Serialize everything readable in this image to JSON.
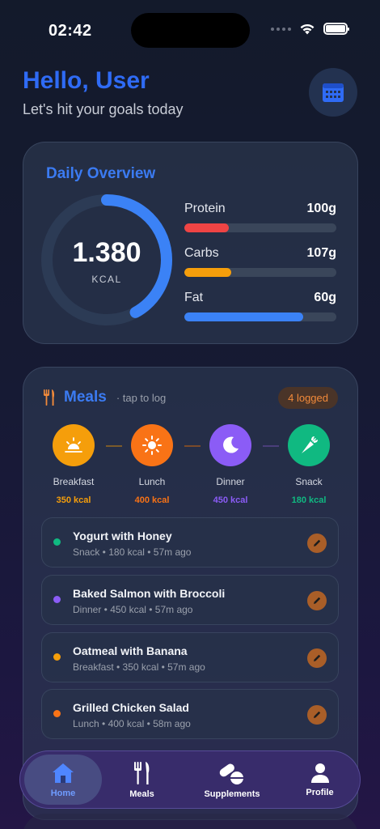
{
  "status": {
    "time": "02:42"
  },
  "header": {
    "greeting": "Hello, User",
    "subtitle": "Let's hit your goals today"
  },
  "overview": {
    "title": "Daily Overview",
    "calories": "1.380",
    "calories_unit": "KCAL",
    "ring_progress": 0.42,
    "macros": [
      {
        "name": "Protein",
        "value": "100g",
        "progress": 0.29,
        "color": "#ef4444"
      },
      {
        "name": "Carbs",
        "value": "107g",
        "progress": 0.31,
        "color": "#f59e0b"
      },
      {
        "name": "Fat",
        "value": "60g",
        "progress": 0.78,
        "color": "#3b82f6"
      }
    ]
  },
  "meals": {
    "title": "Meals",
    "hint": "· tap to log",
    "logged": "4 logged",
    "types": [
      {
        "label": "Breakfast",
        "kcal": "350 kcal",
        "color": "#f59e0b",
        "icon": "sunrise-icon"
      },
      {
        "label": "Lunch",
        "kcal": "400 kcal",
        "color": "#f97316",
        "icon": "sun-icon"
      },
      {
        "label": "Dinner",
        "kcal": "450 kcal",
        "color": "#8b5cf6",
        "icon": "moon-icon"
      },
      {
        "label": "Snack",
        "kcal": "180 kcal",
        "color": "#10b981",
        "icon": "carrot-icon"
      }
    ],
    "items": [
      {
        "name": "Yogurt with Honey",
        "meta": "Snack • 180 kcal • 57m ago",
        "color": "#10b981"
      },
      {
        "name": "Baked Salmon with Broccoli",
        "meta": "Dinner • 450 kcal • 57m ago",
        "color": "#8b5cf6"
      },
      {
        "name": "Oatmeal with Banana",
        "meta": "Breakfast • 350 kcal • 57m ago",
        "color": "#f59e0b"
      },
      {
        "name": "Grilled Chicken Salad",
        "meta": "Lunch • 400 kcal • 58m ago",
        "color": "#f97316"
      }
    ]
  },
  "tabs": [
    {
      "label": "Home",
      "icon": "home-icon",
      "active": true
    },
    {
      "label": "Meals",
      "icon": "fork-knife-icon"
    },
    {
      "label": "Supplements",
      "icon": "pills-icon"
    },
    {
      "label": "Profile",
      "icon": "person-icon"
    }
  ]
}
